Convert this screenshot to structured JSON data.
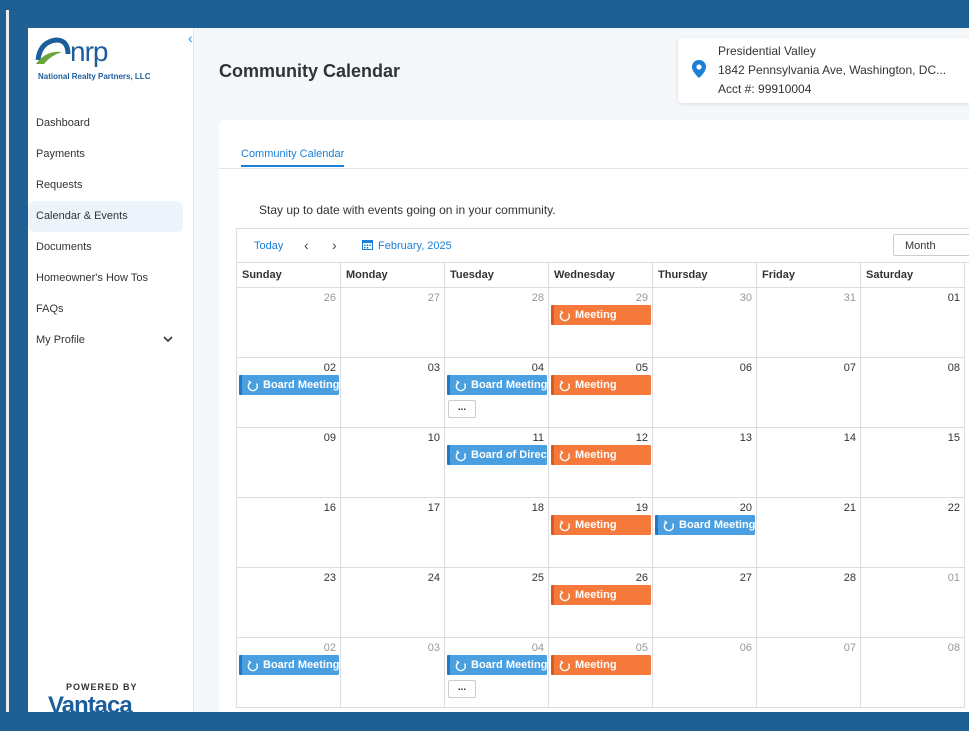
{
  "sidebar": {
    "logo_text": "nrp",
    "logo_subtitle": "National Realty Partners, LLC",
    "items": [
      {
        "label": "Dashboard"
      },
      {
        "label": "Payments"
      },
      {
        "label": "Requests"
      },
      {
        "label": "Calendar & Events"
      },
      {
        "label": "Documents"
      },
      {
        "label": "Homeowner's How Tos"
      },
      {
        "label": "FAQs"
      },
      {
        "label": "My Profile"
      }
    ],
    "powered_by": "POWERED BY",
    "vantaca": "Vantaca"
  },
  "header": {
    "title": "Community Calendar"
  },
  "account": {
    "name": "Presidential Valley",
    "address": "1842 Pennsylvania Ave, Washington, DC...",
    "acct": "Acct #: 99910004"
  },
  "content": {
    "tab": "Community Calendar",
    "intro": "Stay up to date with events going on in your community.",
    "today": "Today",
    "month": "February, 2025",
    "view": "Month",
    "days_of_week": [
      "Sunday",
      "Monday",
      "Tuesday",
      "Wednesday",
      "Thursday",
      "Friday",
      "Saturday"
    ],
    "weeks": [
      {
        "days": [
          {
            "num": "26",
            "other": true,
            "events": []
          },
          {
            "num": "27",
            "other": true,
            "events": []
          },
          {
            "num": "28",
            "other": true,
            "events": []
          },
          {
            "num": "29",
            "other": true,
            "events": [
              {
                "title": "Meeting",
                "color": "orange"
              }
            ]
          },
          {
            "num": "30",
            "other": true,
            "events": []
          },
          {
            "num": "31",
            "other": true,
            "events": []
          },
          {
            "num": "01",
            "other": false,
            "events": []
          }
        ]
      },
      {
        "days": [
          {
            "num": "02",
            "other": false,
            "events": [
              {
                "title": "Board Meeting",
                "color": "blue"
              }
            ]
          },
          {
            "num": "03",
            "other": false,
            "events": []
          },
          {
            "num": "04",
            "other": false,
            "events": [
              {
                "title": "Board Meeting",
                "color": "blue"
              }
            ],
            "more": "..."
          },
          {
            "num": "05",
            "other": false,
            "events": [
              {
                "title": "Meeting",
                "color": "orange"
              }
            ]
          },
          {
            "num": "06",
            "other": false,
            "events": []
          },
          {
            "num": "07",
            "other": false,
            "events": []
          },
          {
            "num": "08",
            "other": false,
            "events": []
          }
        ]
      },
      {
        "days": [
          {
            "num": "09",
            "other": false,
            "events": []
          },
          {
            "num": "10",
            "other": false,
            "events": []
          },
          {
            "num": "11",
            "other": false,
            "events": [
              {
                "title": "Board of Direct",
                "color": "blue"
              }
            ]
          },
          {
            "num": "12",
            "other": false,
            "events": [
              {
                "title": "Meeting",
                "color": "orange"
              }
            ]
          },
          {
            "num": "13",
            "other": false,
            "events": []
          },
          {
            "num": "14",
            "other": false,
            "events": []
          },
          {
            "num": "15",
            "other": false,
            "events": []
          }
        ]
      },
      {
        "days": [
          {
            "num": "16",
            "other": false,
            "events": []
          },
          {
            "num": "17",
            "other": false,
            "events": []
          },
          {
            "num": "18",
            "other": false,
            "events": []
          },
          {
            "num": "19",
            "other": false,
            "events": [
              {
                "title": "Meeting",
                "color": "orange"
              }
            ]
          },
          {
            "num": "20",
            "other": false,
            "events": [
              {
                "title": "Board Meeting",
                "color": "blue"
              }
            ]
          },
          {
            "num": "21",
            "other": false,
            "events": []
          },
          {
            "num": "22",
            "other": false,
            "events": []
          }
        ]
      },
      {
        "days": [
          {
            "num": "23",
            "other": false,
            "events": []
          },
          {
            "num": "24",
            "other": false,
            "events": []
          },
          {
            "num": "25",
            "other": false,
            "events": []
          },
          {
            "num": "26",
            "other": false,
            "events": [
              {
                "title": "Meeting",
                "color": "orange"
              }
            ]
          },
          {
            "num": "27",
            "other": false,
            "events": []
          },
          {
            "num": "28",
            "other": false,
            "events": []
          },
          {
            "num": "01",
            "other": true,
            "events": []
          }
        ]
      },
      {
        "days": [
          {
            "num": "02",
            "other": true,
            "events": [
              {
                "title": "Board Meeting",
                "color": "blue"
              }
            ]
          },
          {
            "num": "03",
            "other": true,
            "events": []
          },
          {
            "num": "04",
            "other": true,
            "events": [
              {
                "title": "Board Meeting",
                "color": "blue"
              }
            ],
            "more": "..."
          },
          {
            "num": "05",
            "other": true,
            "events": [
              {
                "title": "Meeting",
                "color": "orange"
              }
            ]
          },
          {
            "num": "06",
            "other": true,
            "events": []
          },
          {
            "num": "07",
            "other": true,
            "events": []
          },
          {
            "num": "08",
            "other": true,
            "events": []
          }
        ]
      }
    ]
  },
  "colors": {
    "accent": "#1a7fd6",
    "event_blue": "#4a9fe0",
    "event_orange": "#f4793a",
    "frame": "#1e5f94"
  },
  "icons": {
    "collapse": "chevron-left-icon",
    "location": "map-pin-icon",
    "calendar": "calendar-icon",
    "recurring": "recurring-icon",
    "profile_toggle": "chevron-down-icon"
  }
}
